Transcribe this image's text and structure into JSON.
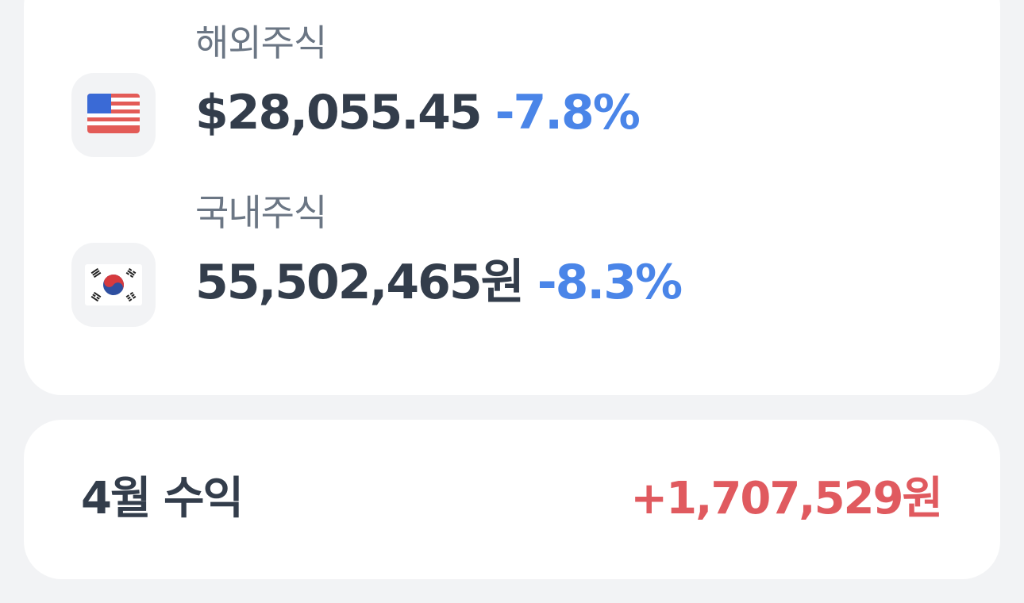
{
  "assets": {
    "overseas": {
      "label": "해외주식",
      "amount": "$28,055.45",
      "change": "-7.8%",
      "flag_icon": "us-flag-icon"
    },
    "domestic": {
      "label": "국내주식",
      "amount": "55,502,465원",
      "change": "-8.3%",
      "flag_icon": "kr-flag-icon"
    }
  },
  "monthly_profit": {
    "label": "4월 수익",
    "value": "+1,707,529원"
  },
  "colors": {
    "background": "#f2f3f5",
    "card": "#ffffff",
    "primary_text": "#333d4b",
    "secondary_text": "#6b7684",
    "loss": "#4a85e8",
    "gain": "#e05a5f"
  }
}
